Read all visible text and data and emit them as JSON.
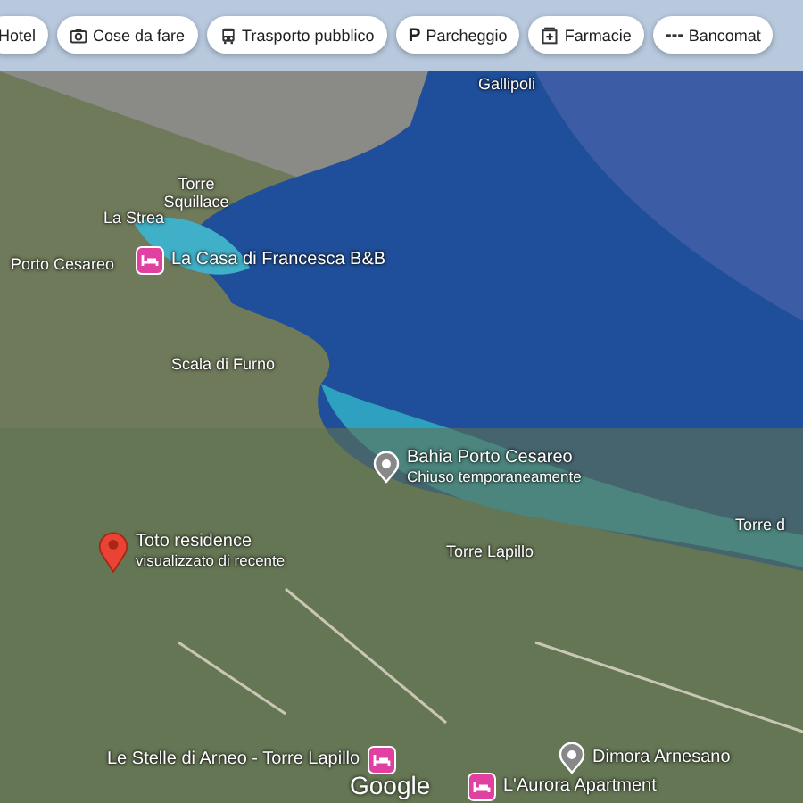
{
  "chips": [
    {
      "label": "Hotel"
    },
    {
      "label": "Cose da fare"
    },
    {
      "label": "Trasporto pubblico"
    },
    {
      "label": "Parcheggio",
      "glyph": "P"
    },
    {
      "label": "Farmacie"
    },
    {
      "label": "Bancomat"
    }
  ],
  "map": {
    "labels": [
      {
        "kind": "place",
        "name": "Gallipoli"
      },
      {
        "kind": "place",
        "name": "Torre Squillace"
      },
      {
        "kind": "place",
        "name": "La Strea"
      },
      {
        "kind": "place",
        "name": "Porto Cesareo"
      },
      {
        "kind": "hotel",
        "name": "La Casa di Francesca B&B"
      },
      {
        "kind": "place",
        "name": "Scala di Furno"
      },
      {
        "kind": "poi",
        "name": "Bahia Porto Cesareo",
        "note": "Chiuso temporaneamente"
      },
      {
        "kind": "place",
        "name": "Torre d"
      },
      {
        "kind": "place",
        "name": "Torre Lapillo"
      },
      {
        "kind": "marker",
        "name": "Toto residence",
        "note": "visualizzato di recente"
      },
      {
        "kind": "hotel-left",
        "name": "Le Stelle di Arneo - Torre Lapillo"
      },
      {
        "kind": "poi",
        "name": "Dimora Arnesano"
      },
      {
        "kind": "hotel-right",
        "name": "L'Aurora Apartment"
      }
    ],
    "attribution": "Google"
  }
}
